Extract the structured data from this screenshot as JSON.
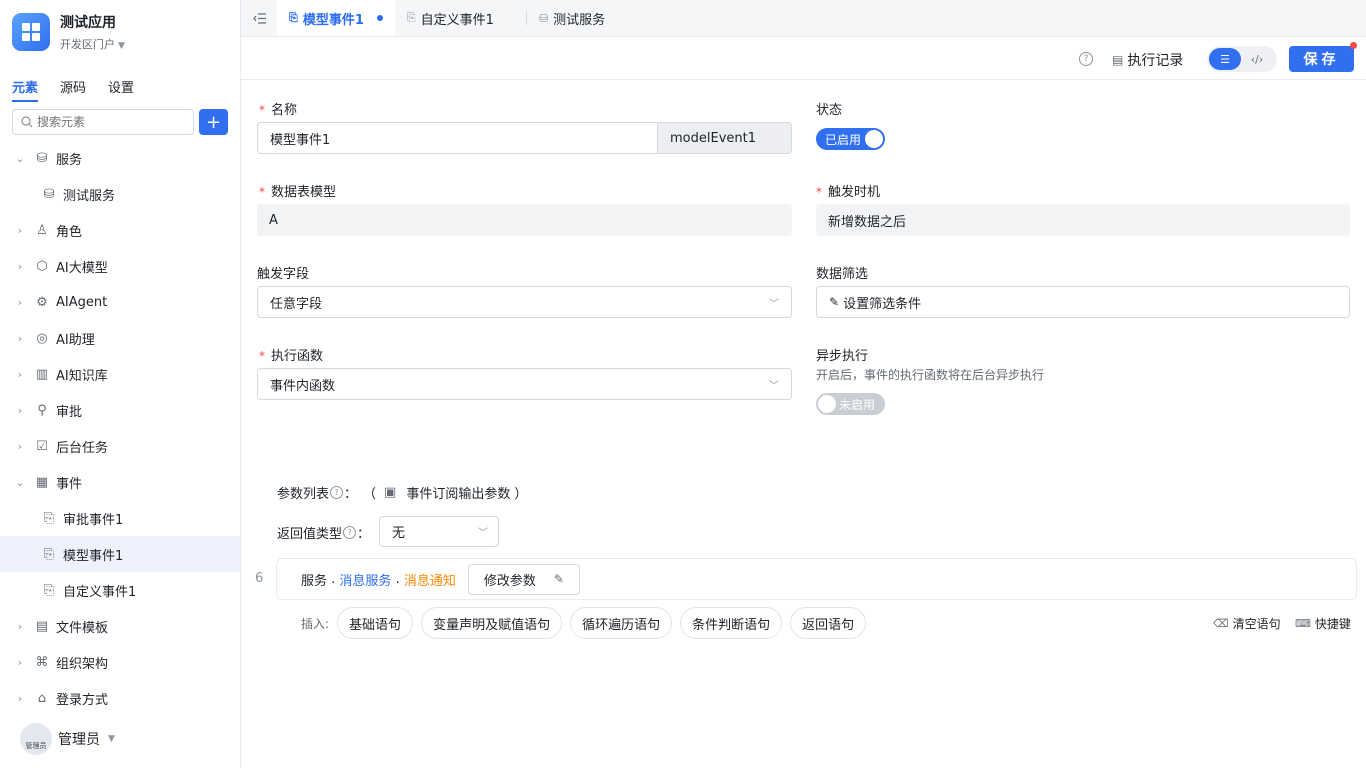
{
  "app": {
    "name": "测试应用",
    "portal": "开发区门户"
  },
  "sidebar": {
    "tabs": [
      "元素",
      "源码",
      "设置"
    ],
    "search_placeholder": "搜索元素",
    "add_label": "+",
    "tree": [
      {
        "label": "服务",
        "arrow": "⌄",
        "icon": "database-icon"
      },
      {
        "label": "测试服务",
        "child": true,
        "icon": "database-icon"
      },
      {
        "label": "角色",
        "arrow": "›",
        "icon": "role-icon"
      },
      {
        "label": "AI大模型",
        "arrow": "›",
        "icon": "cube-icon"
      },
      {
        "label": "AIAgent",
        "arrow": "›",
        "icon": "robot-icon"
      },
      {
        "label": "AI助理",
        "arrow": "›",
        "icon": "ai-assistant-icon"
      },
      {
        "label": "AI知识库",
        "arrow": "›",
        "icon": "book-icon"
      },
      {
        "label": "审批",
        "arrow": "›",
        "icon": "stamp-icon"
      },
      {
        "label": "后台任务",
        "arrow": "›",
        "icon": "task-icon"
      },
      {
        "label": "事件",
        "arrow": "⌄",
        "icon": "calendar-icon"
      },
      {
        "label": "审批事件1",
        "child": true,
        "icon": "event-icon"
      },
      {
        "label": "模型事件1",
        "child": true,
        "selected": true,
        "icon": "event-icon"
      },
      {
        "label": "自定义事件1",
        "child": true,
        "icon": "event-icon"
      },
      {
        "label": "文件模板",
        "arrow": "›",
        "icon": "file-icon"
      },
      {
        "label": "组织架构",
        "arrow": "›",
        "icon": "org-icon"
      },
      {
        "label": "登录方式",
        "arrow": "›",
        "icon": "login-icon"
      }
    ],
    "user": {
      "name": "管理员",
      "avatar_text": "管理员"
    }
  },
  "tabs": [
    {
      "label": "模型事件1",
      "active": true
    },
    {
      "label": "自定义事件1"
    },
    {
      "label": "测试服务"
    }
  ],
  "toolbar": {
    "exec_log": "执行记录",
    "save": "保存"
  },
  "form": {
    "name_label": "名称",
    "name_value": "模型事件1",
    "name_code": "modelEvent1",
    "status_label": "状态",
    "status_on": "已启用",
    "table_label": "数据表模型",
    "table_value": "A",
    "trigger_time_label": "触发时机",
    "trigger_time_value": "新增数据之后",
    "trigger_field_label": "触发字段",
    "trigger_field_value": "任意字段",
    "filter_label": "数据筛选",
    "filter_value": "设置筛选条件",
    "func_label": "执行函数",
    "func_value": "事件内函数",
    "async_label": "异步执行",
    "async_hint": "开启后，事件的执行函数将在后台异步执行",
    "async_off": "未启用"
  },
  "params": {
    "label": "参数列表",
    "colon": "：",
    "open": "（",
    "value": "事件订阅输出参数",
    "close": "）",
    "ret_label": "返回值类型",
    "ret_value": "无"
  },
  "code": {
    "line_no": "6",
    "part1": "服务",
    "dot1": " . ",
    "part2": "消息服务",
    "dot2": " . ",
    "part3": "消息通知",
    "edit": "修改参数"
  },
  "insert": {
    "label": "插入:",
    "buttons": [
      "基础语句",
      "变量声明及赋值语句",
      "循环遍历语句",
      "条件判断语句",
      "返回语句"
    ],
    "clear": "清空语句",
    "shortcut": "快捷键"
  }
}
